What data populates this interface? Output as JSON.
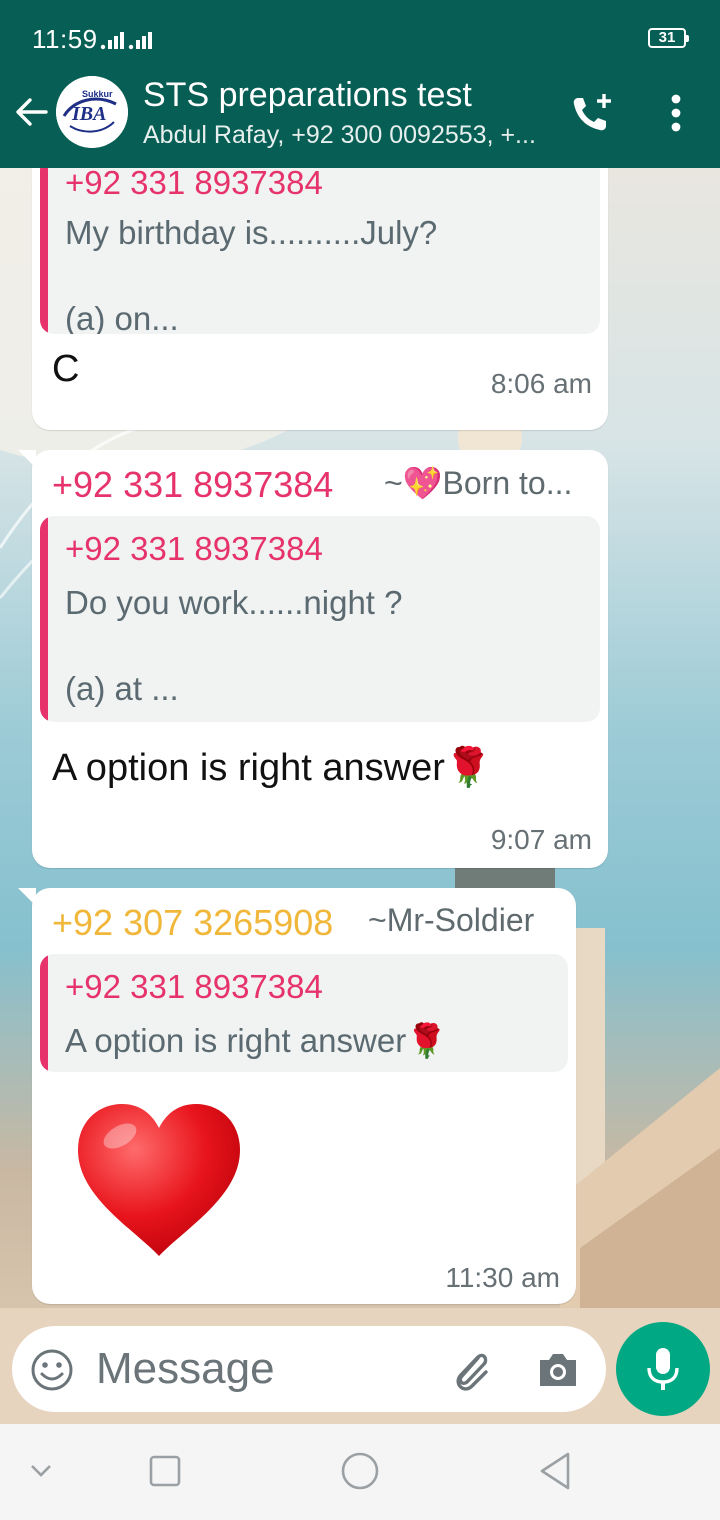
{
  "status_bar": {
    "time": "11:59",
    "battery": "31"
  },
  "header": {
    "group_name": "STS preparations test",
    "participants": "Abdul Rafay, +92 300 0092553, +...",
    "avatar_text_top": "Sukkur",
    "avatar_text_main": "IBA",
    "bg_color": "#075e54",
    "icons": [
      "back-arrow-icon",
      "add-call-icon",
      "more-vertical-icon"
    ]
  },
  "messages": [
    {
      "quote_author": "+92 331 8937384",
      "quote_line1": "My birthday is..........July?",
      "quote_line2": "(a) on...",
      "text": "C",
      "time": "8:06 am"
    },
    {
      "sender": "+92 331 8937384",
      "push_name": "~💖Born to...",
      "quote_author": "+92 331 8937384",
      "quote_line1": "Do you work......night ?",
      "quote_line2": "(a) at ...",
      "text": "A option is right answer🌹",
      "time": "9:07 am"
    },
    {
      "sender": "+92 307 3265908",
      "push_name": "~Mr-Soldier",
      "quote_author": "+92 331 8937384",
      "quote_line1": "A option is right answer🌹",
      "text_emoji": "heart",
      "time": "11:30 am"
    }
  ],
  "composer": {
    "placeholder": "Message",
    "icons": [
      "emoji-icon",
      "paperclip-icon",
      "camera-icon",
      "mic-icon"
    ],
    "mic_color": "#00a884"
  },
  "colors": {
    "sender_pink": "#e6336c",
    "sender_yellow": "#f0b73a"
  }
}
